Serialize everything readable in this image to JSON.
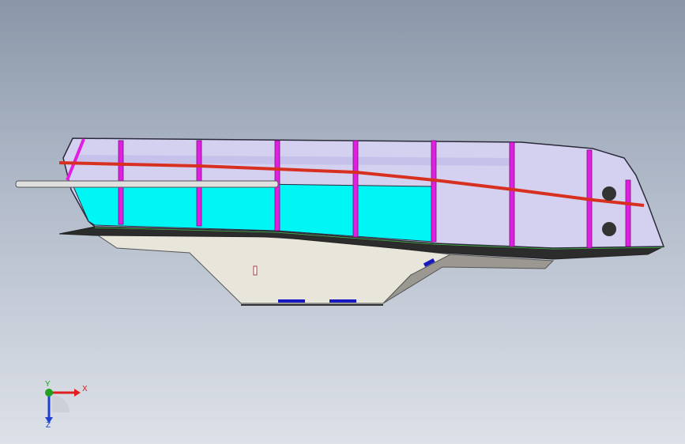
{
  "viewport": {
    "background_top": "#8a97a8",
    "background_bottom": "#dde1e8"
  },
  "model": {
    "colors": {
      "hull_top": "#d4d0ef",
      "hull_outline": "#2a2a3a",
      "cyan_panel": "#00f5f5",
      "magenta_ribs": "#e020e0",
      "red_rail": "#d83020",
      "green_deck": "#48c048",
      "dark_deck": "#2c2c2c",
      "keel_body": "#e8e6da",
      "keel_shadow": "#9a9890",
      "blue_pads": "#1818c0",
      "pipe": "#e0e0e0"
    }
  },
  "triad": {
    "x_label": "X",
    "y_label": "Y",
    "z_label": "Z",
    "x_color": "#e02020",
    "y_color": "#20a020",
    "z_color": "#2040d0"
  }
}
